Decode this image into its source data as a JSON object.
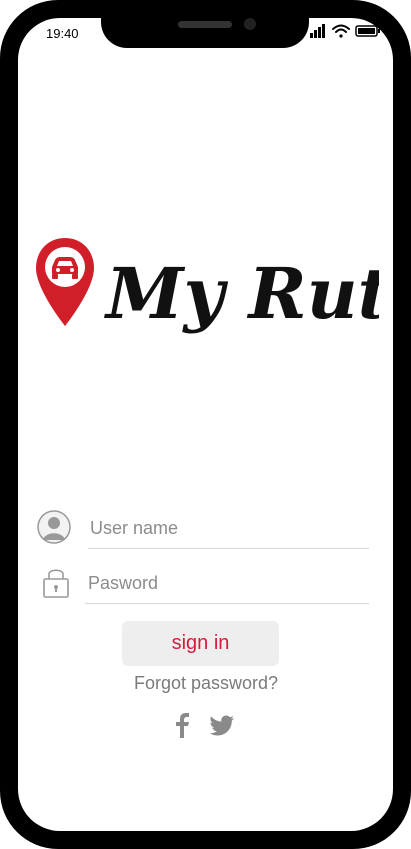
{
  "status_bar": {
    "time": "19:40"
  },
  "brand": {
    "name": "My Rute",
    "accent": "#d11f2a"
  },
  "form": {
    "username_placeholder": "User name",
    "password_placeholder": "Pasword"
  },
  "actions": {
    "sign_in_label": "sign in",
    "forgot_label": "Forgot password?"
  },
  "social": {
    "icons": [
      "facebook-icon",
      "twitter-icon"
    ]
  },
  "colors": {
    "sign_in_text": "#d81b3c",
    "muted": "#8c8c8c"
  }
}
